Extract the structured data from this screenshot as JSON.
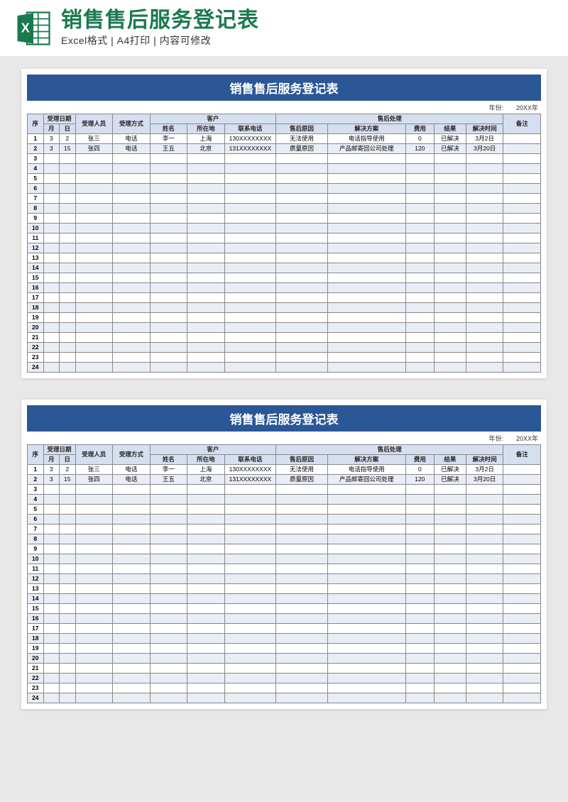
{
  "header": {
    "main_title": "销售售后服务登记表",
    "sub_title": "Excel格式 | A4打印 | 内容可修改"
  },
  "sheet": {
    "title": "销售售后服务登记表",
    "year_label": "年份:",
    "year_value": "20XX年",
    "columns": {
      "seq": "序",
      "date_group": "受理日期",
      "month": "月",
      "day": "日",
      "person": "受理人员",
      "method": "受理方式",
      "customer_group": "客户",
      "name": "姓名",
      "location": "所在地",
      "phone": "联系电话",
      "after_group": "售后处理",
      "reason": "售后原因",
      "solution": "解决方案",
      "cost": "费用",
      "result": "结果",
      "resolve_time": "解决时间",
      "note": "备注"
    },
    "rows": [
      {
        "seq": "1",
        "month": "3",
        "day": "2",
        "person": "张三",
        "method": "电话",
        "name": "李一",
        "location": "上海",
        "phone": "130XXXXXXXX",
        "reason": "无法使用",
        "solution": "电话指导使用",
        "cost": "0",
        "result": "已解决",
        "resolve_time": "3月2日",
        "note": ""
      },
      {
        "seq": "2",
        "month": "3",
        "day": "15",
        "person": "张四",
        "method": "电话",
        "name": "王五",
        "location": "北京",
        "phone": "131XXXXXXXX",
        "reason": "质量原因",
        "solution": "产品邮寄回公司处理",
        "cost": "120",
        "result": "已解决",
        "resolve_time": "3月20日",
        "note": ""
      }
    ],
    "empty_rows": 22
  }
}
